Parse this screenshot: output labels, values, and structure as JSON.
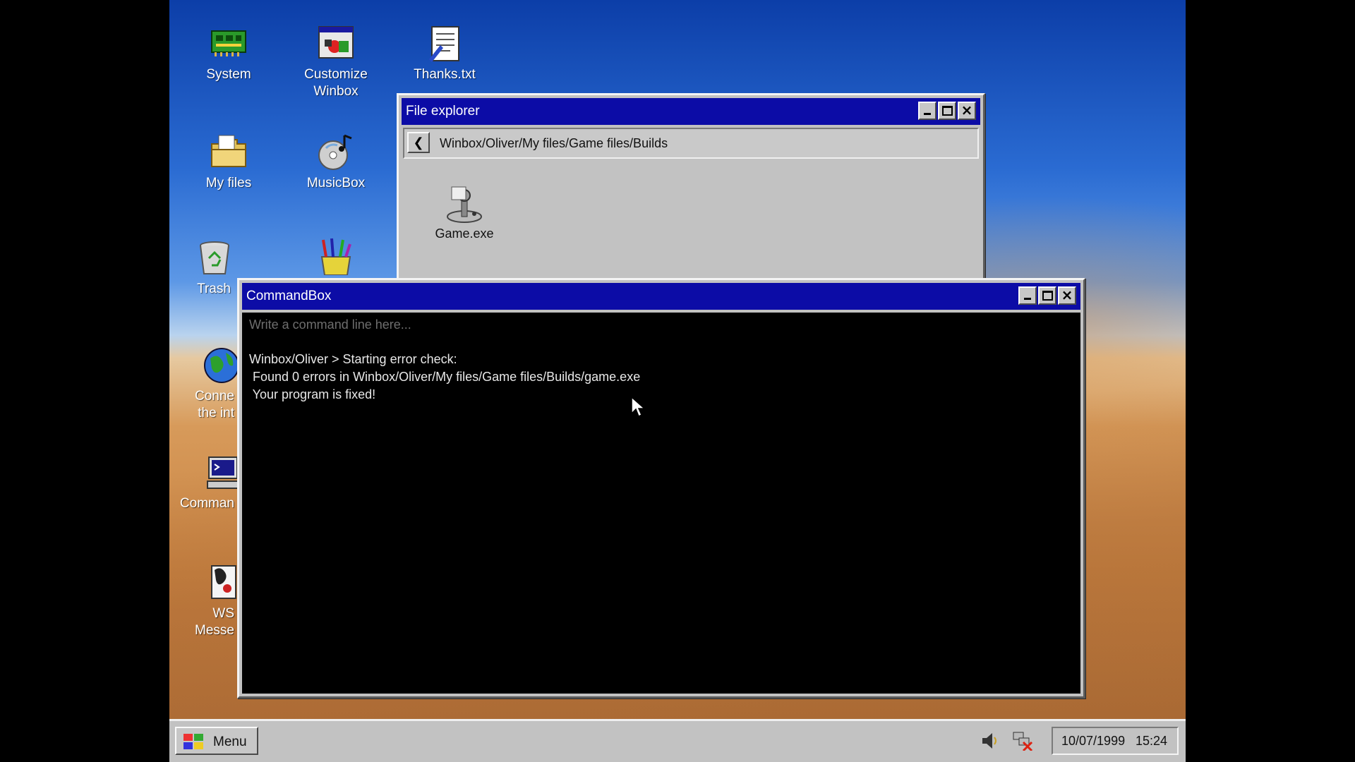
{
  "desktop": {
    "icons": [
      {
        "label": "System",
        "icon": "system-icon"
      },
      {
        "label": "Customize Winbox",
        "line1": "Customize",
        "line2": "Winbox",
        "icon": "customize-icon"
      },
      {
        "label": "Thanks.txt",
        "icon": "text-file-icon"
      },
      {
        "label": "My files",
        "icon": "folder-icon"
      },
      {
        "label": "MusicBox",
        "icon": "musicbox-icon"
      },
      {
        "label": "Trash",
        "icon": "trash-icon"
      },
      {
        "label": "",
        "icon": "paint-icon"
      },
      {
        "label": "Conne the int",
        "line1": "Conne",
        "line2": "the int",
        "icon": "globe-icon"
      },
      {
        "label": "Comman",
        "icon": "command-icon"
      },
      {
        "label": "WS Messe",
        "line1": "WS",
        "line2": "Messe",
        "icon": "messenger-icon"
      }
    ]
  },
  "file_explorer": {
    "title": "File explorer",
    "path": "Winbox/Oliver/My files/Game files/Builds",
    "back_icon": "back-arrow-icon",
    "items": [
      {
        "label": "Game.exe",
        "icon": "joystick-icon"
      }
    ]
  },
  "command_box": {
    "title": "CommandBox",
    "input_placeholder": "Write a command line here...",
    "output": [
      "Winbox/Oliver > Starting error check:",
      " Found 0 errors in Winbox/Oliver/My files/Game files/Builds/game.exe",
      " Your program is fixed!"
    ]
  },
  "window_controls": {
    "minimize": "minimize-icon",
    "maximize": "maximize-icon",
    "close": "×"
  },
  "taskbar": {
    "menu_label": "Menu",
    "date": "10/07/1999",
    "time": "15:24",
    "tray_icons": [
      "speaker-icon",
      "network-disconnected-icon"
    ]
  },
  "colors": {
    "titlebar": "#0c0ca6",
    "window_face": "#c2c2c2",
    "console_bg": "#000000"
  }
}
